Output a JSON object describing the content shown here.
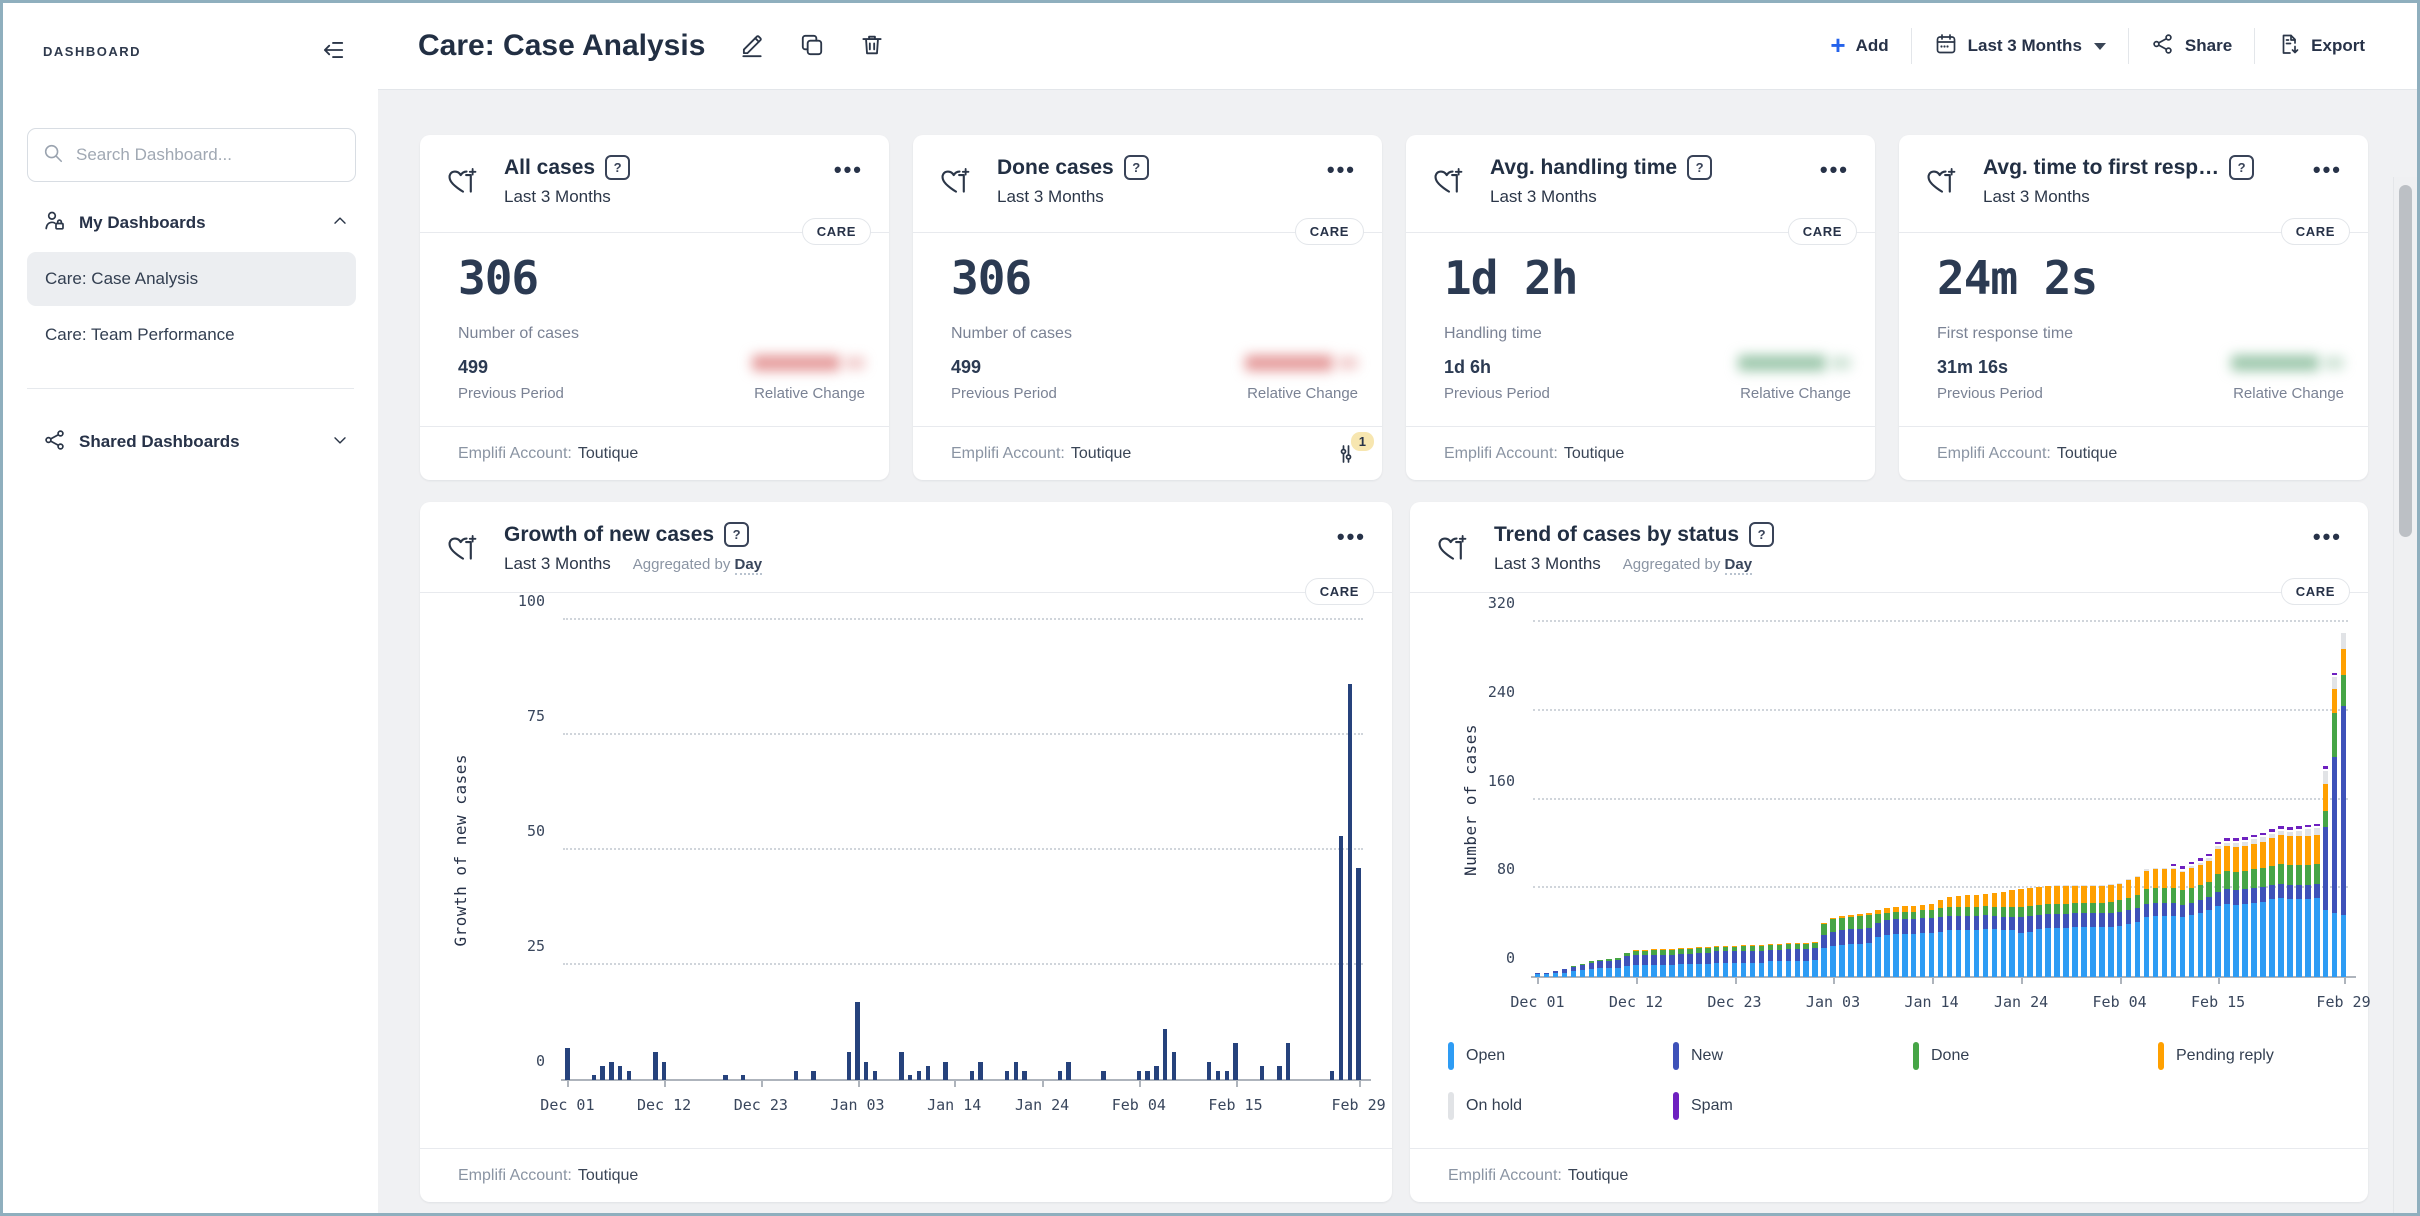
{
  "sidebar": {
    "title": "DASHBOARD",
    "search_placeholder": "Search Dashboard...",
    "my_dashboards": {
      "label": "My Dashboards",
      "items": [
        {
          "label": "Care: Case Analysis",
          "selected": true
        },
        {
          "label": "Care: Team Performance",
          "selected": false
        }
      ]
    },
    "shared_dashboards": {
      "label": "Shared Dashboards"
    }
  },
  "header": {
    "title": "Care: Case Analysis",
    "add_label": "Add",
    "date_range_label": "Last 3 Months",
    "share_label": "Share",
    "export_label": "Export"
  },
  "kpi_cards": [
    {
      "title": "All cases",
      "period": "Last 3 Months",
      "badge": "CARE",
      "value": "306",
      "value_label": "Number of cases",
      "previous_value": "499",
      "previous_label": "Previous Period",
      "relative_label": "Relative Change",
      "relative_change_tone": "negative",
      "account_label": "Emplifi Account:",
      "account_value": "Toutique"
    },
    {
      "title": "Done cases",
      "period": "Last 3 Months",
      "badge": "CARE",
      "value": "306",
      "value_label": "Number of cases",
      "previous_value": "499",
      "previous_label": "Previous Period",
      "relative_label": "Relative Change",
      "relative_change_tone": "negative",
      "account_label": "Emplifi Account:",
      "account_value": "Toutique",
      "filter_badge_count": "1"
    },
    {
      "title": "Avg. handling time",
      "period": "Last 3 Months",
      "badge": "CARE",
      "value": "1d 2h",
      "value_label": "Handling time",
      "previous_value": "1d 6h",
      "previous_label": "Previous Period",
      "relative_label": "Relative Change",
      "relative_change_tone": "positive",
      "account_label": "Emplifi Account:",
      "account_value": "Toutique"
    },
    {
      "title": "Avg. time to first resp…",
      "period": "Last 3 Months",
      "badge": "CARE",
      "value": "24m 2s",
      "value_label": "First response time",
      "previous_value": "31m 16s",
      "previous_label": "Previous Period",
      "relative_label": "Relative Change",
      "relative_change_tone": "positive",
      "account_label": "Emplifi Account:",
      "account_value": "Toutique"
    }
  ],
  "chart_cards": [
    {
      "title": "Growth of new cases",
      "period": "Last 3 Months",
      "aggregated_prefix": "Aggregated by",
      "aggregated_by": "Day",
      "badge": "CARE",
      "account_label": "Emplifi Account:",
      "account_value": "Toutique"
    },
    {
      "title": "Trend of cases by status",
      "period": "Last 3 Months",
      "aggregated_prefix": "Aggregated by",
      "aggregated_by": "Day",
      "badge": "CARE",
      "account_label": "Emplifi Account:",
      "account_value": "Toutique"
    }
  ],
  "chart_data": [
    {
      "type": "bar",
      "title": "Growth of new cases",
      "ylabel": "Growth of new cases",
      "ylim": [
        0,
        100
      ],
      "yticks": [
        0,
        25,
        50,
        75,
        100
      ],
      "grid": "dotted-horizontal",
      "bar_color": "#26427c",
      "x_tick_labels": [
        "Dec 01",
        "Dec 12",
        "Dec 23",
        "Jan 03",
        "Jan 14",
        "Jan 24",
        "Feb 04",
        "Feb 15",
        "Feb 29"
      ],
      "x_tick_days": [
        0,
        11,
        22,
        33,
        44,
        54,
        65,
        76,
        90
      ],
      "x_range_note": "daily values, Dec 01 - Feb 29",
      "values": [
        7,
        0,
        0,
        1,
        3,
        4,
        3,
        2,
        0,
        0,
        6,
        4,
        0,
        0,
        0,
        0,
        0,
        0,
        1,
        0,
        1,
        0,
        0,
        0,
        0,
        0,
        2,
        0,
        2,
        0,
        0,
        0,
        6,
        17,
        4,
        2,
        0,
        0,
        6,
        1,
        2,
        3,
        0,
        4,
        0,
        0,
        2,
        4,
        0,
        0,
        2,
        4,
        2,
        0,
        0,
        0,
        2,
        4,
        0,
        0,
        0,
        2,
        0,
        0,
        0,
        2,
        2,
        3,
        11,
        6,
        0,
        0,
        0,
        4,
        2,
        2,
        8,
        0,
        0,
        3,
        0,
        3,
        8,
        0,
        0,
        0,
        0,
        2,
        53,
        86,
        46
      ]
    },
    {
      "type": "stacked_bar",
      "title": "Trend of cases by status",
      "ylabel": "Number of cases",
      "ylim": [
        0,
        320
      ],
      "yticks": [
        0,
        80,
        160,
        240,
        320
      ],
      "grid": "dotted-horizontal",
      "legend_position": "bottom",
      "x_tick_labels": [
        "Dec 01",
        "Dec 12",
        "Dec 23",
        "Jan 03",
        "Jan 14",
        "Jan 24",
        "Feb 04",
        "Feb 15",
        "Feb 29"
      ],
      "x_tick_days": [
        0,
        11,
        22,
        33,
        44,
        54,
        65,
        76,
        90
      ],
      "x_range_note": "daily stacks, Dec 01 - Feb 29",
      "series_meta": [
        {
          "name": "Open",
          "color": "#2e9cf4"
        },
        {
          "name": "New",
          "color": "#3e52b9"
        },
        {
          "name": "Done",
          "color": "#46a546"
        },
        {
          "name": "Pending reply",
          "color": "#ffa000"
        },
        {
          "name": "On hold",
          "color": "#e1e3e6"
        },
        {
          "name": "Spam",
          "color": "#6e20c0"
        }
      ],
      "stacks": [
        [
          3,
          1,
          0,
          0,
          0,
          0
        ],
        [
          3,
          1,
          0,
          0,
          0,
          0
        ],
        [
          4,
          1,
          0,
          0,
          0,
          0
        ],
        [
          4,
          3,
          0,
          0,
          0,
          0
        ],
        [
          5,
          4,
          1,
          0,
          0,
          0
        ],
        [
          6,
          5,
          1,
          0,
          0,
          0
        ],
        [
          7,
          6,
          1,
          0,
          0,
          0
        ],
        [
          8,
          6,
          1,
          0,
          0,
          0
        ],
        [
          8,
          6,
          2,
          0,
          0,
          0
        ],
        [
          8,
          7,
          2,
          0,
          0,
          0
        ],
        [
          10,
          9,
          3,
          0,
          0,
          0
        ],
        [
          11,
          9,
          3,
          1,
          0,
          0
        ],
        [
          11,
          9,
          3,
          1,
          0,
          0
        ],
        [
          11,
          9,
          4,
          1,
          0,
          0
        ],
        [
          11,
          9,
          4,
          1,
          0,
          0
        ],
        [
          11,
          9,
          4,
          1,
          0,
          0
        ],
        [
          12,
          9,
          4,
          1,
          0,
          0
        ],
        [
          12,
          9,
          4,
          1,
          0,
          0
        ],
        [
          12,
          10,
          4,
          1,
          0,
          0
        ],
        [
          12,
          10,
          4,
          1,
          0,
          0
        ],
        [
          13,
          10,
          4,
          1,
          0,
          0
        ],
        [
          13,
          10,
          4,
          1,
          0,
          0
        ],
        [
          13,
          10,
          4,
          1,
          0,
          0
        ],
        [
          13,
          10,
          5,
          1,
          0,
          0
        ],
        [
          13,
          10,
          5,
          1,
          0,
          0
        ],
        [
          13,
          10,
          5,
          1,
          0,
          0
        ],
        [
          14,
          10,
          5,
          1,
          0,
          0
        ],
        [
          14,
          10,
          5,
          1,
          0,
          0
        ],
        [
          14,
          11,
          5,
          1,
          0,
          0
        ],
        [
          14,
          11,
          5,
          1,
          0,
          0
        ],
        [
          14,
          11,
          5,
          1,
          0,
          0
        ],
        [
          15,
          11,
          5,
          1,
          0,
          0
        ],
        [
          26,
          12,
          10,
          1,
          0,
          0
        ],
        [
          28,
          13,
          11,
          1,
          0,
          0
        ],
        [
          29,
          13,
          11,
          2,
          0,
          0
        ],
        [
          30,
          13,
          11,
          2,
          0,
          0
        ],
        [
          30,
          13,
          12,
          2,
          0,
          0
        ],
        [
          31,
          13,
          12,
          2,
          0,
          0
        ],
        [
          36,
          13,
          8,
          3,
          0,
          0
        ],
        [
          38,
          13,
          7,
          4,
          0,
          0
        ],
        [
          39,
          13,
          7,
          4,
          0,
          0
        ],
        [
          39,
          13,
          7,
          5,
          0,
          0
        ],
        [
          39,
          13,
          7,
          5,
          0,
          0
        ],
        [
          40,
          13,
          7,
          5,
          0,
          0
        ],
        [
          40,
          13,
          7,
          6,
          0,
          0
        ],
        [
          41,
          13,
          8,
          7,
          0,
          0
        ],
        [
          42,
          13,
          8,
          9,
          0,
          0
        ],
        [
          42,
          13,
          8,
          10,
          0,
          0
        ],
        [
          42,
          13,
          8,
          11,
          0,
          0
        ],
        [
          42,
          13,
          8,
          11,
          0,
          0
        ],
        [
          43,
          13,
          8,
          11,
          0,
          0
        ],
        [
          43,
          12,
          8,
          13,
          0,
          0
        ],
        [
          42,
          12,
          9,
          14,
          0,
          0
        ],
        [
          42,
          12,
          9,
          15,
          0,
          0
        ],
        [
          40,
          14,
          9,
          16,
          0,
          0
        ],
        [
          41,
          14,
          9,
          16,
          0,
          0
        ],
        [
          43,
          13,
          9,
          16,
          0,
          0
        ],
        [
          44,
          13,
          9,
          16,
          0,
          0
        ],
        [
          44,
          13,
          9,
          16,
          1,
          0
        ],
        [
          44,
          13,
          9,
          16,
          1,
          0
        ],
        [
          45,
          13,
          9,
          15,
          1,
          0
        ],
        [
          45,
          13,
          9,
          15,
          1,
          0
        ],
        [
          45,
          13,
          9,
          15,
          1,
          0
        ],
        [
          45,
          13,
          9,
          15,
          1,
          0
        ],
        [
          45,
          13,
          10,
          15,
          1,
          0
        ],
        [
          46,
          13,
          10,
          15,
          1,
          0
        ],
        [
          48,
          12,
          11,
          16,
          1,
          0
        ],
        [
          50,
          12,
          12,
          16,
          1,
          0
        ],
        [
          54,
          12,
          13,
          17,
          1,
          0
        ],
        [
          55,
          12,
          13,
          17,
          1,
          0
        ],
        [
          55,
          12,
          13,
          17,
          1,
          0
        ],
        [
          55,
          12,
          13,
          17,
          1,
          1
        ],
        [
          54,
          11,
          13,
          17,
          1,
          1
        ],
        [
          56,
          11,
          13,
          18,
          2,
          1
        ],
        [
          58,
          11,
          14,
          18,
          2,
          1
        ],
        [
          60,
          12,
          14,
          19,
          2,
          1
        ],
        [
          64,
          13,
          16,
          22,
          3,
          2
        ],
        [
          66,
          13,
          17,
          22,
          3,
          2
        ],
        [
          65,
          13,
          17,
          22,
          4,
          2
        ],
        [
          66,
          13,
          17,
          22,
          4,
          2
        ],
        [
          67,
          13,
          17,
          23,
          4,
          2
        ],
        [
          68,
          13,
          17,
          24,
          4,
          2
        ],
        [
          70,
          13,
          17,
          25,
          4,
          2
        ],
        [
          71,
          13,
          18,
          26,
          4,
          2
        ],
        [
          70,
          13,
          18,
          26,
          4,
          2
        ],
        [
          70,
          13,
          18,
          26,
          5,
          2
        ],
        [
          70,
          13,
          18,
          26,
          6,
          2
        ],
        [
          71,
          13,
          18,
          26,
          6,
          2
        ],
        [
          60,
          75,
          15,
          24,
          12,
          2
        ],
        [
          58,
          140,
          40,
          22,
          10,
          2
        ],
        [
          56,
          188,
          28,
          24,
          14,
          0
        ]
      ]
    }
  ]
}
